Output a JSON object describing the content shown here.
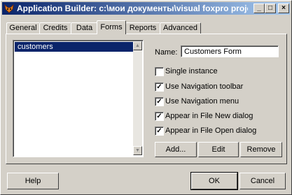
{
  "window": {
    "title": "Application Builder: c:\\мои документы\\visual foxpro projects\\bo...",
    "icon": "fox-icon"
  },
  "title_buttons": {
    "minimize": "_",
    "maximize": "□",
    "close": "×"
  },
  "tabs": [
    {
      "label": "General"
    },
    {
      "label": "Credits"
    },
    {
      "label": "Data"
    },
    {
      "label": "Forms"
    },
    {
      "label": "Reports"
    },
    {
      "label": "Advanced"
    }
  ],
  "forms_list": {
    "items": [
      "customers"
    ]
  },
  "name_field": {
    "label": "Name:",
    "value": "Customers Form"
  },
  "options": [
    {
      "label": "Single instance",
      "checked": false
    },
    {
      "label": "Use Navigation toolbar",
      "checked": true
    },
    {
      "label": "Use Navigation menu",
      "checked": true
    },
    {
      "label": "Appear in File New dialog",
      "checked": true
    },
    {
      "label": "Appear in File Open dialog",
      "checked": true
    }
  ],
  "panel_buttons": {
    "add": "Add...",
    "edit": "Edit",
    "remove": "Remove"
  },
  "dialog_buttons": {
    "help": "Help",
    "ok": "OK",
    "cancel": "Cancel"
  }
}
